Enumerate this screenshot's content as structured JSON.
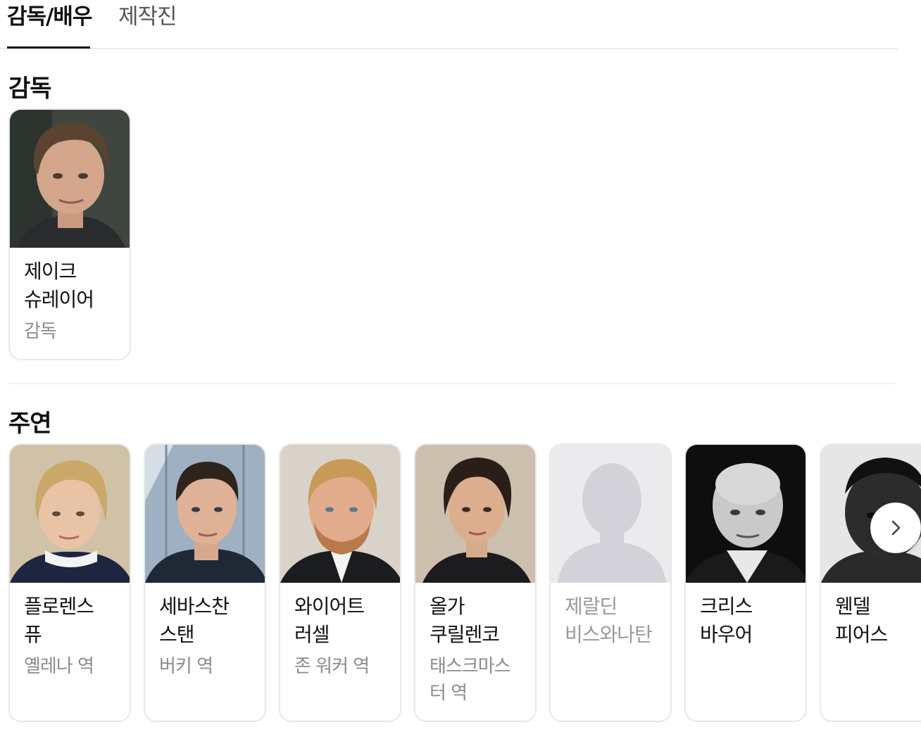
{
  "tabs": [
    {
      "label": "감독/배우",
      "active": true
    },
    {
      "label": "제작진",
      "active": false
    }
  ],
  "director_section": {
    "title": "감독",
    "people": [
      {
        "name": "제이크 슈레이어",
        "role": "감독",
        "photo": "portrait"
      }
    ]
  },
  "cast_section": {
    "title": "주연",
    "people": [
      {
        "name": "플로렌스 퓨",
        "role": "옐레나 역",
        "photo": "portrait"
      },
      {
        "name": "세바스찬 스탠",
        "role": "버키 역",
        "photo": "portrait"
      },
      {
        "name": "와이어트 러셀",
        "role": "존 워커 역",
        "photo": "portrait"
      },
      {
        "name": "올가 쿠릴렌코",
        "role": "태스크마스터 역",
        "photo": "portrait"
      },
      {
        "name": "제랄딘 비스와나탄",
        "role": "",
        "photo": "placeholder-silhouette"
      },
      {
        "name": "크리스 바우어",
        "role": "",
        "photo": "portrait"
      },
      {
        "name": "웬델 피어스",
        "role": "",
        "photo": "portrait"
      }
    ]
  },
  "icons": {
    "next": "chevron-right-icon",
    "placeholder": "person-silhouette-icon"
  }
}
